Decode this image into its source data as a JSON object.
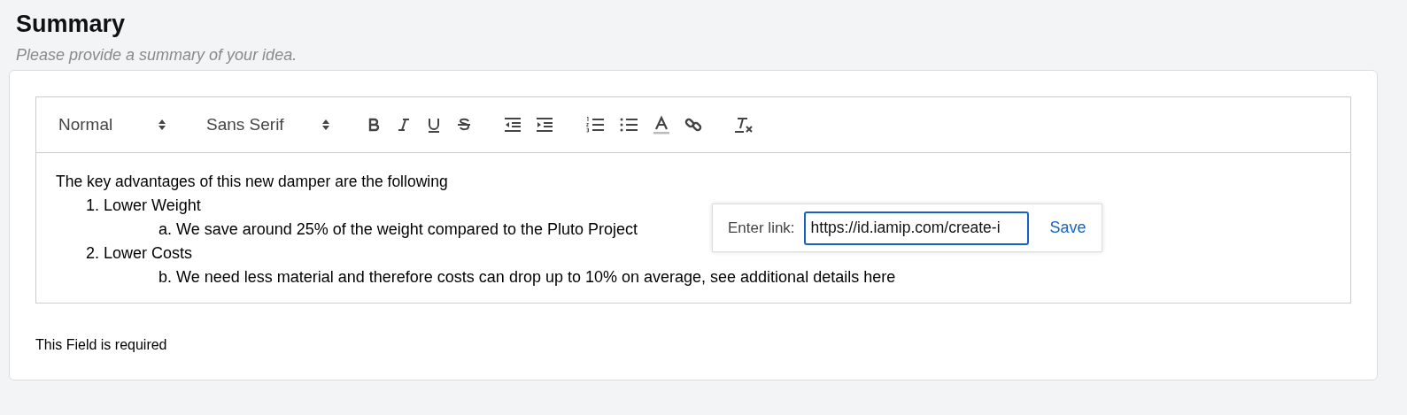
{
  "section": {
    "title": "Summary",
    "hint": "Please provide a summary of your idea."
  },
  "editor": {
    "pickers": [
      {
        "label": "Normal"
      },
      {
        "label": "Sans Serif"
      }
    ],
    "intro": "The key advantages of this new damper are the following",
    "list": [
      {
        "marker": "1.",
        "text": "Lower Weight",
        "children": [
          {
            "marker": "a.",
            "text": "We save around 25% of the weight compared to the Pluto Project"
          }
        ]
      },
      {
        "marker": "2.",
        "text": "Lower Costs",
        "children": [
          {
            "marker": "b.",
            "text": "We need less material and therefore costs can drop up to 10% on average, see additional details here"
          }
        ]
      }
    ],
    "link_tooltip": {
      "label": "Enter link:",
      "value": "https://id.iamip.com/create-i",
      "button": "Save"
    }
  },
  "validation": "This Field is required"
}
